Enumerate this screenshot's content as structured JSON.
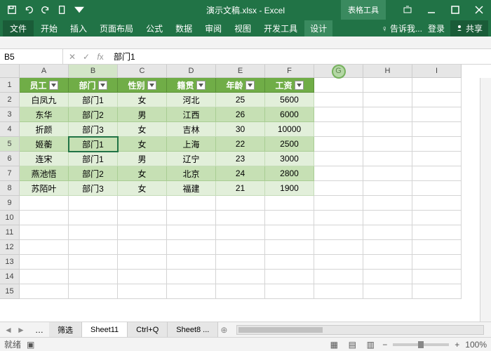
{
  "title": "演示文稿.xlsx - Excel",
  "context_tab": "表格工具",
  "menu": {
    "file": "文件",
    "items": [
      "开始",
      "插入",
      "页面布局",
      "公式",
      "数据",
      "审阅",
      "视图",
      "开发工具",
      "设计"
    ],
    "active": "设计",
    "tell_me": "告诉我...",
    "login": "登录",
    "share": "共享"
  },
  "name_box": "B5",
  "formula": "部门1",
  "columns": [
    "A",
    "B",
    "C",
    "D",
    "E",
    "F",
    "G",
    "H",
    "I"
  ],
  "sel_col": "B",
  "sel_row": 5,
  "headers": [
    "员工",
    "部门",
    "性别",
    "籍贯",
    "年龄",
    "工资"
  ],
  "rows": [
    [
      "白凤九",
      "部门1",
      "女",
      "河北",
      "25",
      "5600"
    ],
    [
      "东华",
      "部门2",
      "男",
      "江西",
      "26",
      "6000"
    ],
    [
      "折颜",
      "部门3",
      "女",
      "吉林",
      "30",
      "10000"
    ],
    [
      "姬蘅",
      "部门1",
      "女",
      "上海",
      "22",
      "2500"
    ],
    [
      "连宋",
      "部门1",
      "男",
      "辽宁",
      "23",
      "3000"
    ],
    [
      "燕池悟",
      "部门2",
      "女",
      "北京",
      "24",
      "2800"
    ],
    [
      "苏陌叶",
      "部门3",
      "女",
      "福建",
      "21",
      "1900"
    ]
  ],
  "row_count": 15,
  "sheets": [
    "筛选",
    "Sheet11",
    "Ctrl+Q",
    "Sheet8 ..."
  ],
  "active_sheet": "Sheet11",
  "status": "就绪",
  "zoom": "100%",
  "cursor_pos": {
    "col": "G",
    "row": 0
  }
}
